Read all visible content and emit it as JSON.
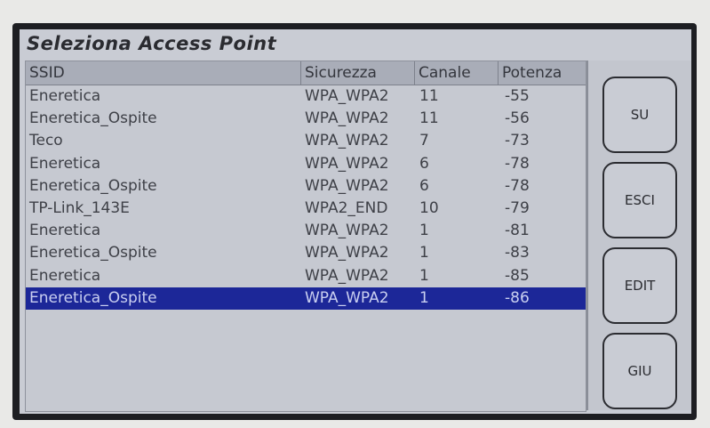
{
  "screen_title": "Seleziona Access Point",
  "table": {
    "headers": {
      "ssid": "SSID",
      "security": "Sicurezza",
      "channel": "Canale",
      "power": "Potenza"
    },
    "rows": [
      {
        "ssid": "Eneretica",
        "security": "WPA_WPA2",
        "channel": "11",
        "power": "-55"
      },
      {
        "ssid": "Eneretica_Ospite",
        "security": "WPA_WPA2",
        "channel": "11",
        "power": "-56"
      },
      {
        "ssid": "Teco",
        "security": "WPA_WPA2",
        "channel": "7",
        "power": "-73"
      },
      {
        "ssid": "Eneretica",
        "security": "WPA_WPA2",
        "channel": "6",
        "power": "-78"
      },
      {
        "ssid": "Eneretica_Ospite",
        "security": "WPA_WPA2",
        "channel": "6",
        "power": "-78"
      },
      {
        "ssid": "TP-Link_143E",
        "security": "WPA2_END",
        "channel": "10",
        "power": "-79"
      },
      {
        "ssid": "Eneretica",
        "security": "WPA_WPA2",
        "channel": "1",
        "power": "-81"
      },
      {
        "ssid": "Eneretica_Ospite",
        "security": "WPA_WPA2",
        "channel": "1",
        "power": "-83"
      },
      {
        "ssid": "Eneretica",
        "security": "WPA_WPA2",
        "channel": "1",
        "power": "-85"
      },
      {
        "ssid": "Eneretica_Ospite",
        "security": "WPA_WPA2",
        "channel": "1",
        "power": "-86"
      }
    ],
    "selected_index": 9
  },
  "buttons": {
    "up": "SU",
    "exit": "ESCI",
    "edit": "EDIT",
    "down": "GIU"
  },
  "colors": {
    "selection": "#1c2798",
    "header_bg": "#a9adb8",
    "screen_bg": "#c9ccd4"
  }
}
